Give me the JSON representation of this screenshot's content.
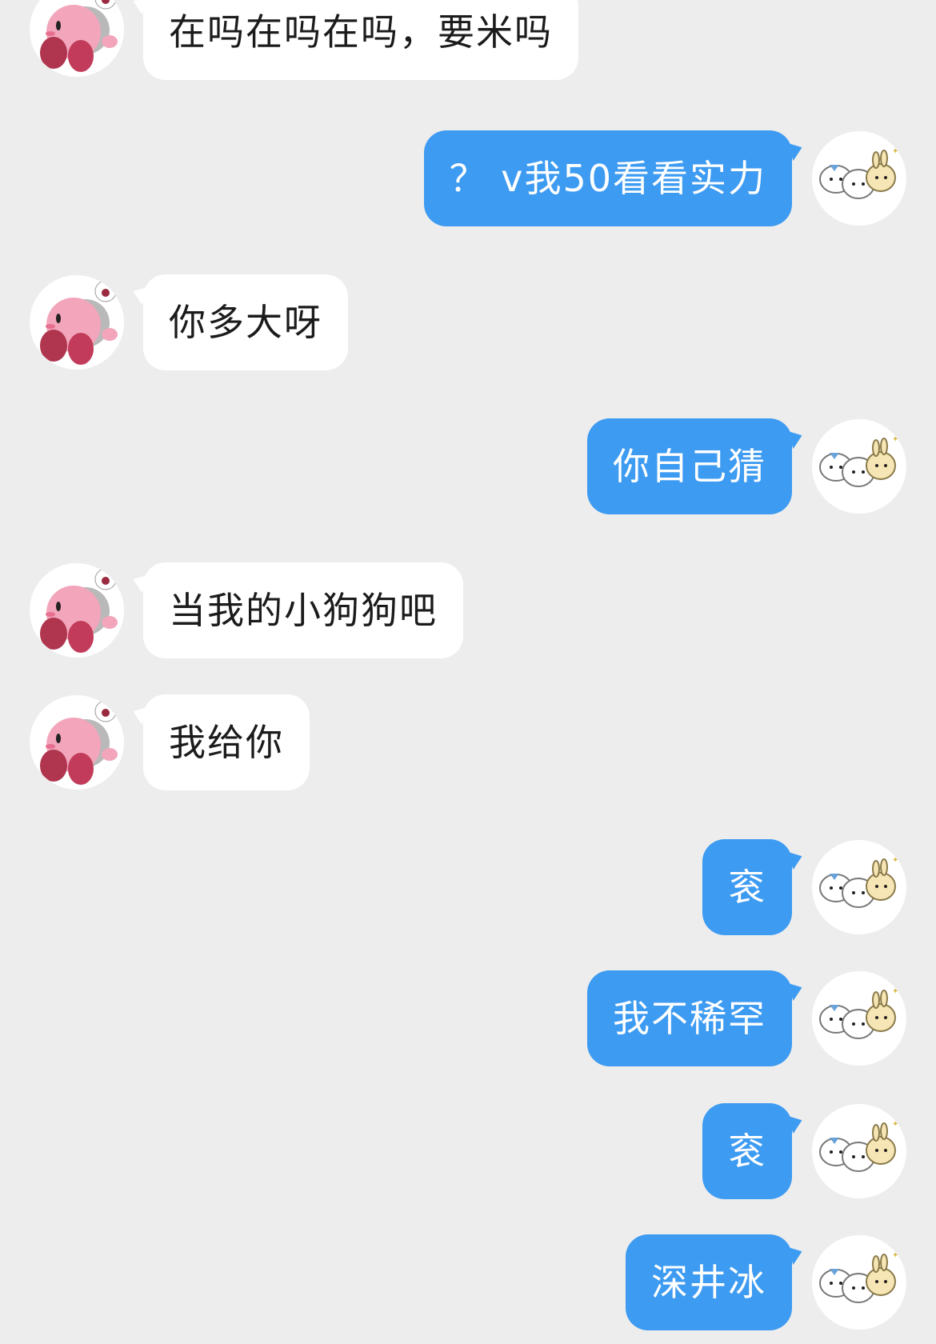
{
  "conversation": {
    "messages": [
      {
        "side": "left",
        "text": "在吗在吗在吗，要米吗"
      },
      {
        "side": "right",
        "text": "？ v我50看看实力"
      },
      {
        "side": "left",
        "text": "你多大呀"
      },
      {
        "side": "right",
        "text": "你自己猜"
      },
      {
        "side": "left",
        "text": "当我的小狗狗吧"
      },
      {
        "side": "left",
        "text": "我给你"
      },
      {
        "side": "right",
        "text": "衮"
      },
      {
        "side": "right",
        "text": "我不稀罕"
      },
      {
        "side": "right",
        "text": "衮"
      },
      {
        "side": "right",
        "text": "深井冰"
      }
    ]
  },
  "avatars": {
    "left": "kirby-with-headphones-icon",
    "right": "three-cute-animals-icon"
  },
  "colors": {
    "background": "#ededed",
    "left_bubble": "#ffffff",
    "right_bubble": "#3d9bf2",
    "left_text": "#1b1b1b",
    "right_text": "#ffffff"
  }
}
